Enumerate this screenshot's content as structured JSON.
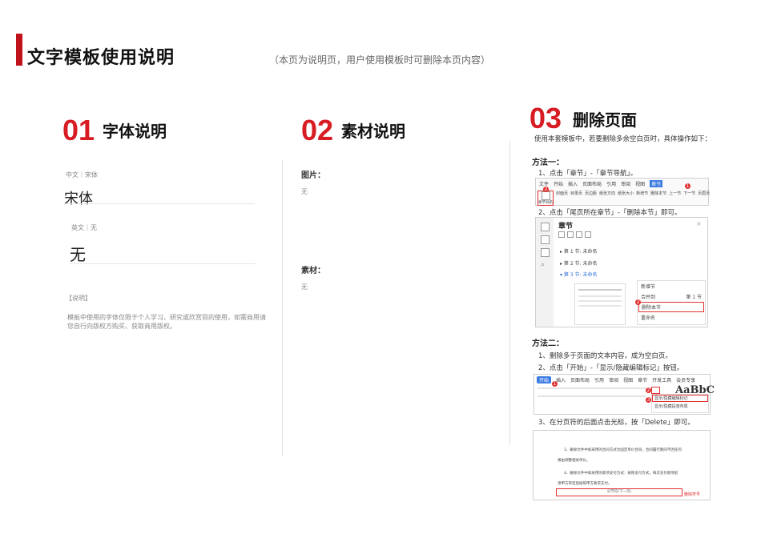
{
  "page": {
    "title": "文字模板使用说明",
    "note": "（本页为说明页，用户使用模板时可删除本页内容）"
  },
  "font_section": {
    "number": "01",
    "title": "字体说明",
    "cn_label": "中文｜宋体",
    "cn_value": "宋体",
    "en_label": "英文｜无",
    "en_value": "无",
    "desc_tag": "【说明】",
    "desc_text": "模板中使用的字体仅限于个人学习、研究或欣赏目的使用，如需商用请您自行向版权方购买、获取商用版权。"
  },
  "material_section": {
    "number": "02",
    "title": "素材说明",
    "images_label": "图片：",
    "images_value": "无",
    "assets_label": "素材：",
    "assets_value": "无"
  },
  "delete_section": {
    "number": "03",
    "title": "删除页面",
    "intro": "使用本套模板中，若要删除多余空白页时，具体操作如下：",
    "method1_title": "方法一：",
    "method1_step1": "1、点击「章节」-「章节导航」。",
    "method1_step2": "2、点击「尾页所在章节」-「删除本节」即可。",
    "method2_title": "方法二：",
    "method2_step1": "1、删除多于页面的文本内容，成为空白页。",
    "method2_step2": "2、点击「开始」-「显示/隐藏编辑标记」按钮。",
    "method2_step3": "3、在分页符的后面点击光标，按「Delete」即可。",
    "shot1": {
      "menu": [
        "文件",
        "开始",
        "插入",
        "页面布局",
        "引用",
        "审阅",
        "视图",
        "章节"
      ],
      "nav_btn": "章节导航",
      "tools": [
        "封面页",
        "目录页",
        "页边距",
        "纸张方向",
        "纸张大小",
        "新增节",
        "删除本节",
        "上一节",
        "下一节",
        "页眉页"
      ]
    },
    "shot2": {
      "panel_title": "章节",
      "items": [
        "第 1 节: 未命名",
        "第 2 节: 未命名",
        "第 3 节: 未命名"
      ],
      "menu": [
        "新增节",
        "合并到",
        "删除本节",
        "重命名"
      ],
      "merge_value": "第 1 节"
    },
    "shot3": {
      "tabs": [
        "开始",
        "插入",
        "页面布局",
        "引用",
        "审阅",
        "视图",
        "章节",
        "开发工具",
        "会员专享"
      ],
      "menu": [
        "显示/隐藏编辑标记",
        "显示/隐藏段落布局"
      ],
      "sample": "AaBbC"
    },
    "shot4": {
      "lines": [
        "3、删除文件中如采用的合同方式为固定单价合同，合同履行期间不因任何",
        "缘由调整相关单价。",
        "4、删除文件中如采用的款项支付方式：按照支付方式，每次支付款项前",
        "须甲方审定后按照甲方要求支付。"
      ],
      "break": "分节符(下一页)",
      "break_label": "删除符号"
    }
  },
  "colors": {
    "accent": "#d71c24",
    "highlight": "#e23030"
  }
}
